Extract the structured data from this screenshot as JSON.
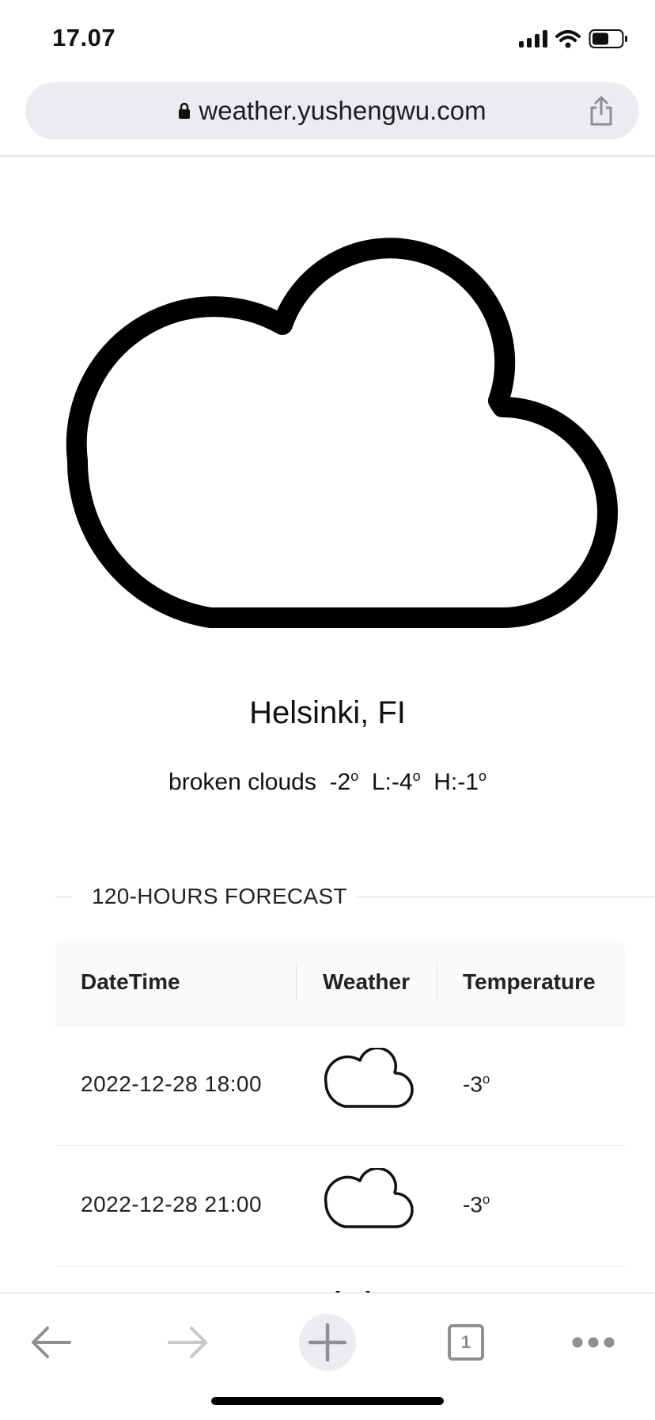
{
  "status_bar": {
    "time": "17.07"
  },
  "browser": {
    "url": "weather.yushengwu.com"
  },
  "current": {
    "city": "Helsinki, FI",
    "condition": "broken clouds",
    "temp": "-2",
    "low_label": "L:-4",
    "high_label": "H:-1",
    "degree_symbol": "o",
    "icon": "cloud-icon"
  },
  "forecast": {
    "title": "120-HOURS FORECAST",
    "columns": [
      "DateTime",
      "Weather",
      "Temperature"
    ],
    "rows": [
      {
        "datetime": "2022-12-28 18:00",
        "icon": "cloud-icon",
        "temp": "-3"
      },
      {
        "datetime": "2022-12-28 21:00",
        "icon": "cloud-icon",
        "temp": "-3"
      }
    ]
  },
  "toolbar": {
    "tab_count": "1"
  },
  "colors": {
    "url_bar_bg": "#ebecef",
    "icon_gray": "#8e8e93"
  }
}
